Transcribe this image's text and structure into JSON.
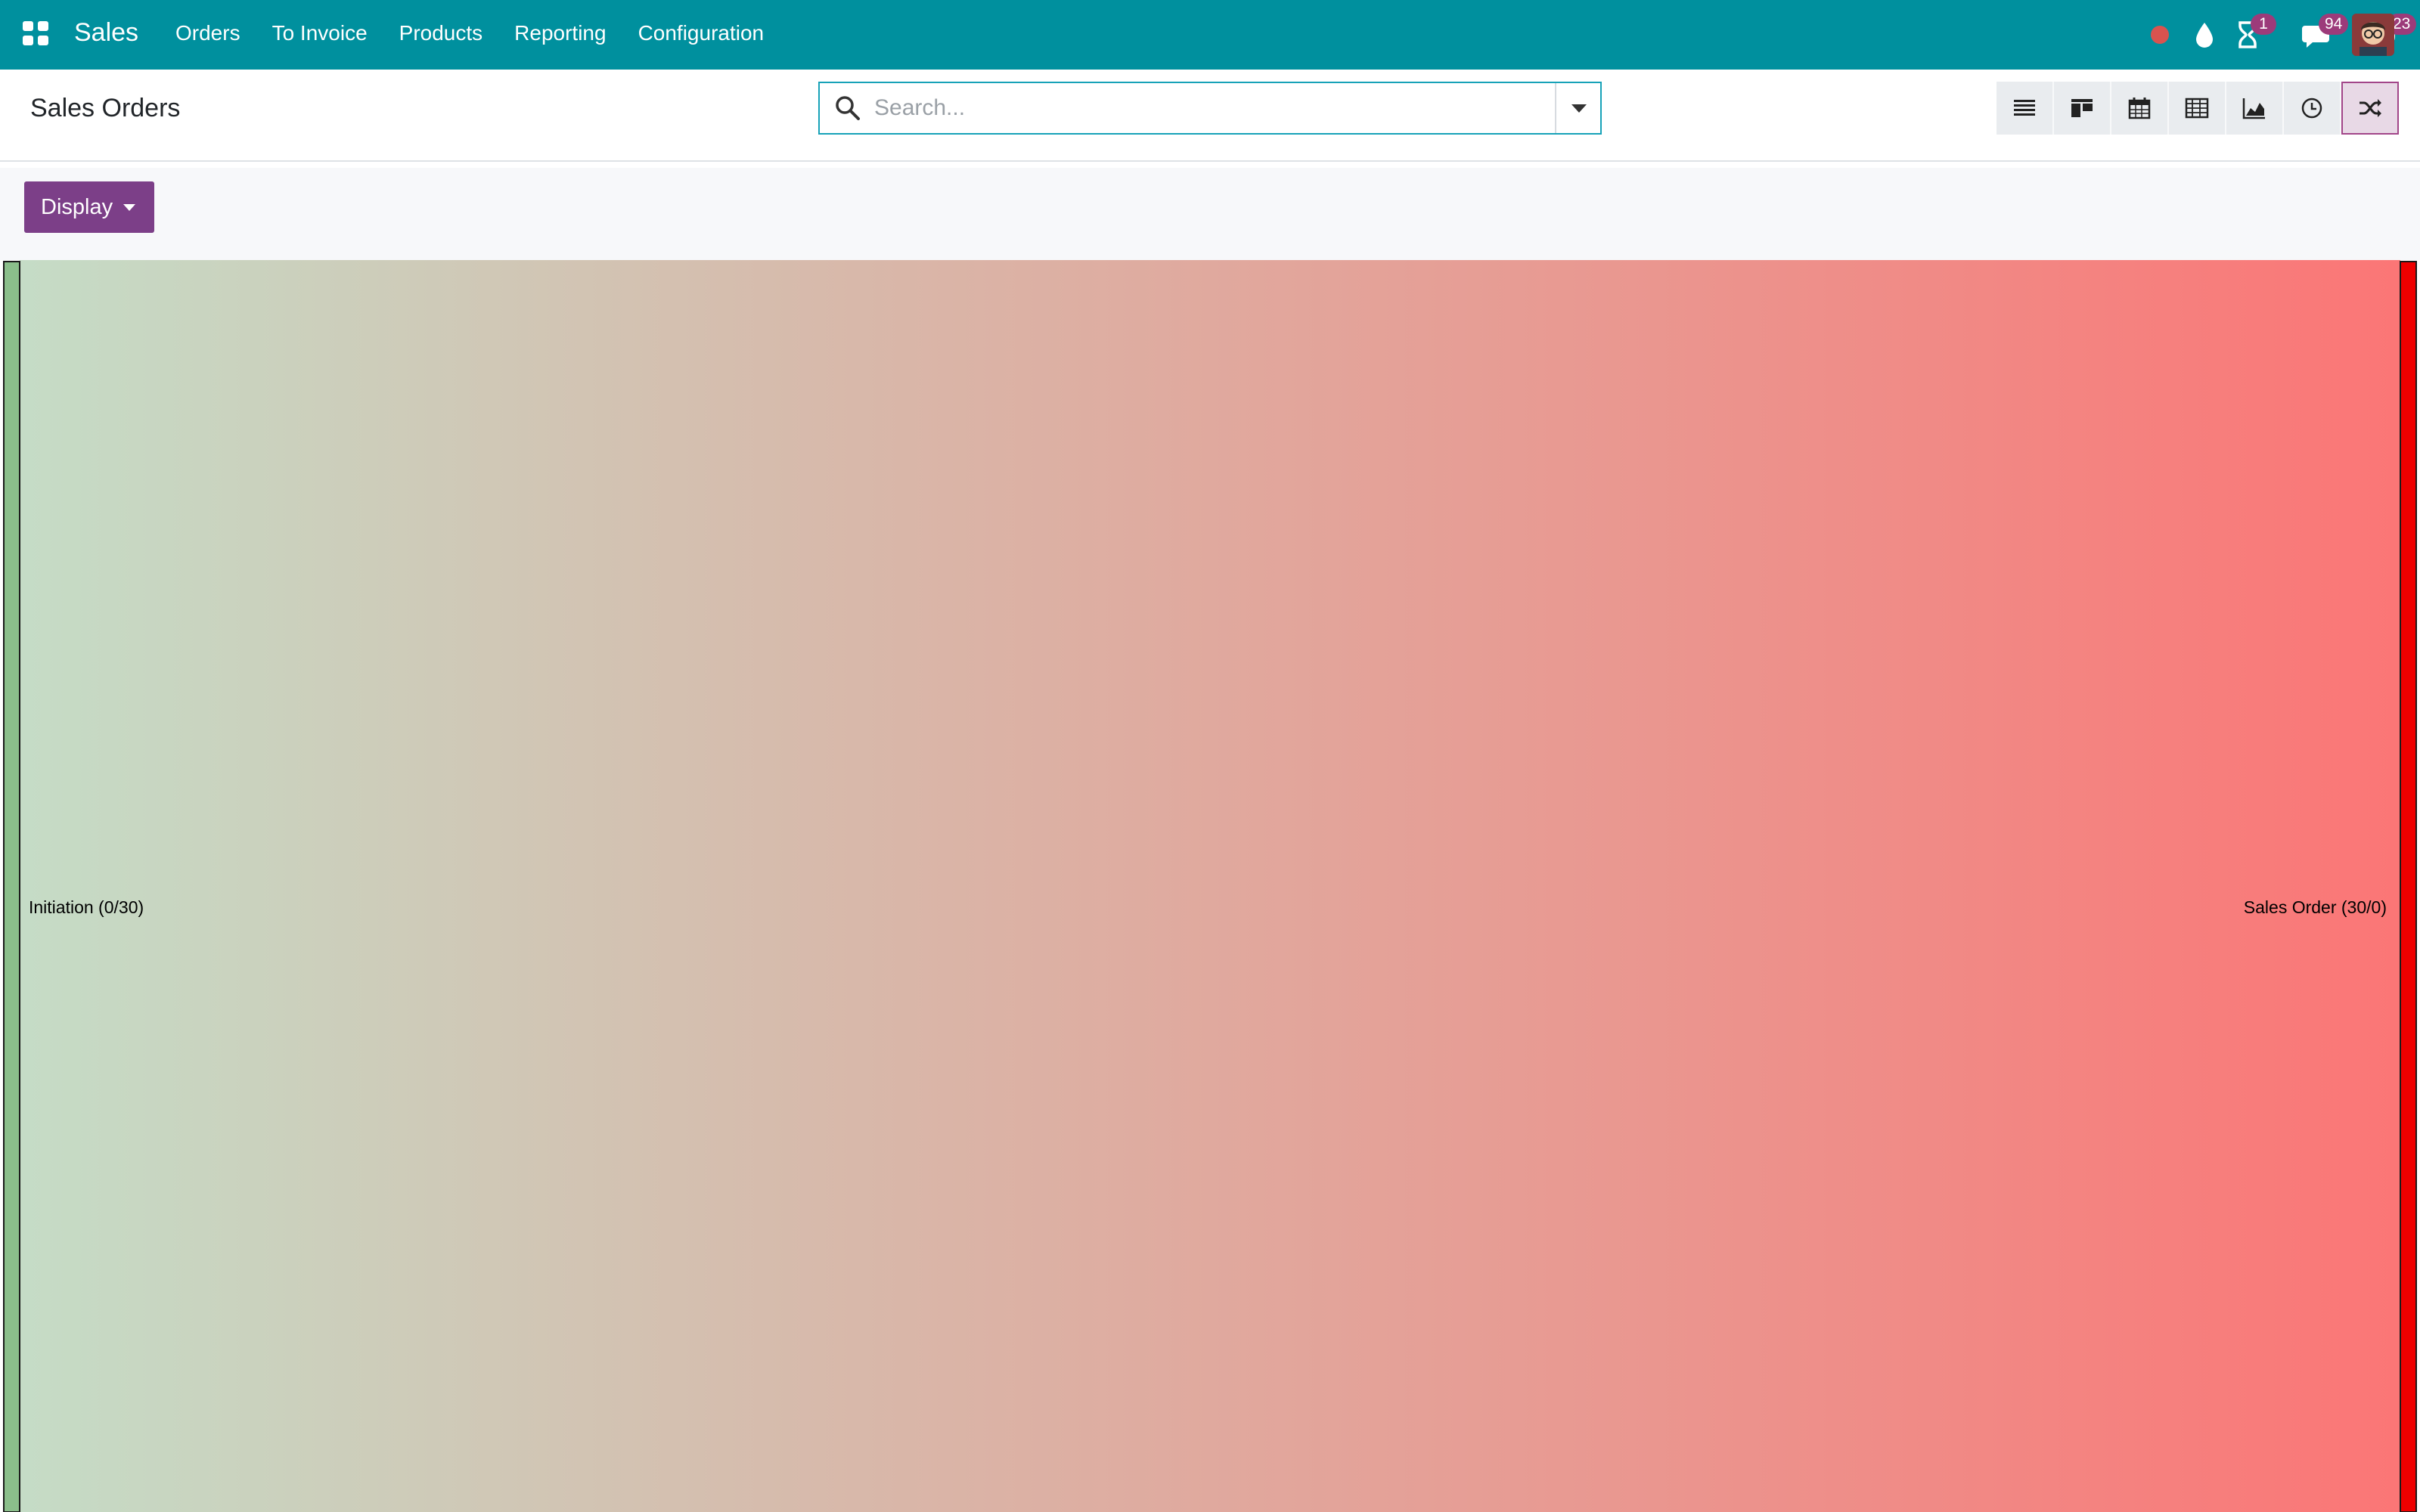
{
  "navbar": {
    "app_name": "Sales",
    "menu": [
      {
        "label": "Orders"
      },
      {
        "label": "To Invoice"
      },
      {
        "label": "Products"
      },
      {
        "label": "Reporting"
      },
      {
        "label": "Configuration"
      }
    ],
    "systray": {
      "activity_count": "1",
      "messages_count": "94",
      "timer_count": "23"
    }
  },
  "control_panel": {
    "title": "Sales Orders",
    "search": {
      "placeholder": "Search..."
    },
    "views": [
      "list",
      "kanban",
      "calendar",
      "pivot",
      "graph",
      "activity",
      "sankey"
    ],
    "active_view": "sankey"
  },
  "subbar": {
    "display_label": "Display"
  },
  "sankey": {
    "nodes": [
      {
        "label": "Initiation (0/30)",
        "color": "#8bbf8b"
      },
      {
        "label": "Sales Order (30/0)",
        "color": "#ee0000"
      }
    ],
    "gradient": {
      "from": "#c5dcc6",
      "to": "#fb7676"
    }
  },
  "colors": {
    "navbar": "#00909e",
    "primary": "#7c3f88",
    "badge": "#9c3b7a",
    "search_border": "#17a2b8"
  }
}
